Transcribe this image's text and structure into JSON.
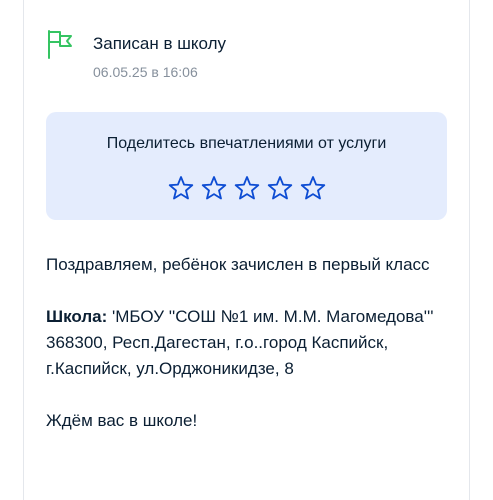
{
  "status": {
    "title": "Записан в школу",
    "timestamp": "06.05.25 в 16:06",
    "icon": "flag-icon",
    "icon_color": "#35c462"
  },
  "feedback": {
    "prompt": "Поделитесь впечатлениями от услуги",
    "rating": 0,
    "max_rating": 5,
    "star_color": "#0d4cd3",
    "background": "#e4ecfd"
  },
  "message": {
    "congrats": "Поздравляем, ребёнок зачислен в первый класс",
    "school_label": "Школа:",
    "school_value": " 'МБОУ ''СОШ №1 им. М.М. Магомедова''' 368300, Респ.Дагестан, г.о..город Каспийск, г.Каспийск, ул.Орджоникидзе, 8",
    "closing": "Ждём вас в школе!"
  }
}
